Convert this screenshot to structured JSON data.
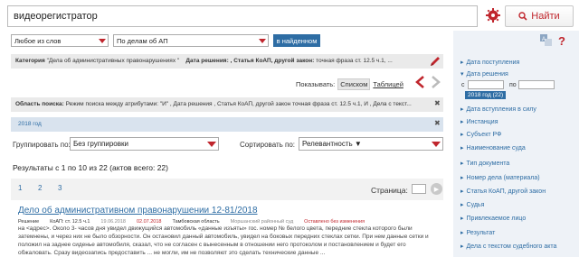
{
  "search": {
    "query": "видеорегистратор",
    "find_label": "Найти"
  },
  "filters": {
    "mode": "Любое из слов",
    "scope": "По делам об АП",
    "in_found": "в найденном"
  },
  "category_row": {
    "cat_label": "Категория",
    "cat_value": "\"Дела об административных правонарушениях \"",
    "date_label": "Дата решения:",
    "law_label": ", Статья КоАП, другой закон:",
    "law_value": "точная фраза ст. 12.5 ч.1, ..."
  },
  "show": {
    "label": "Показывать:",
    "list": "Списком",
    "table": "Таблицей"
  },
  "area_row": {
    "label": "Область поиска:",
    "value": "Режим поиска между атрибутами: \"И\" , Дата решения , Статья КоАП, другой закон точная фраза ст. 12.5 ч.1, И , Дела с текст..."
  },
  "year_row": {
    "value": "2018 год"
  },
  "grouping": {
    "label": "Группировать по:",
    "value": "Без группировки"
  },
  "sorting": {
    "label": "Сортировать по:",
    "value": "Релевантность ▼"
  },
  "results": {
    "text": "Результаты с 1 по 10 из 22 (актов всего: 22)"
  },
  "pager": {
    "pages": [
      "1",
      "2",
      "3"
    ],
    "page_label": "Страница:"
  },
  "doc": {
    "title": "Дело об административном правонарушении 12-81/2018",
    "meta": [
      "Решение",
      "КоАП: ст. 12.5 ч.1",
      "19.06.2018",
      "02.07.2018",
      "Тамбовская область",
      "Моршанский районный суд",
      "Оставлено без изменения"
    ],
    "snippet": "на <адрес>. Около 3- часов дня увидел движущийся автомобиль «данные изъяты» гос. номер № белого цвета, передние стекла которого были затемнены, и через них не было обзорности. Он остановил данный автомобиль, увидел на боковых передних стеклах сетки. При нем данные сетки и положил на заднее сиденье автомобиля, сказал, что не согласен с вынесенным в отношении него протоколом и постановлением и будет его обжаловать. Сразу видеозапись предоставить ... не могли, им не позволяют это сделать технические данные ..."
  },
  "sidebar": {
    "items": [
      {
        "label": "Дата поступления"
      },
      {
        "label": "Дата решения"
      },
      {
        "label": "Дата вступления в силу"
      },
      {
        "label": "Инстанция"
      },
      {
        "label": "Субъект РФ"
      },
      {
        "label": "Наименование суда"
      },
      {
        "label": "Тип документа"
      },
      {
        "label": "Номер дела (материала)"
      },
      {
        "label": "Статья КоАП, другой закон"
      },
      {
        "label": "Судья"
      },
      {
        "label": "Привлекаемое лицо"
      },
      {
        "label": "Результат"
      },
      {
        "label": "Дела с текстом судебного акта"
      }
    ],
    "date_from_label": "с",
    "date_to_label": "по",
    "year_chip": "2018 год (22)"
  },
  "colors": {
    "accent": "#c0262d",
    "link": "#2e6da4",
    "sidebar_bg": "#eef2f7"
  }
}
